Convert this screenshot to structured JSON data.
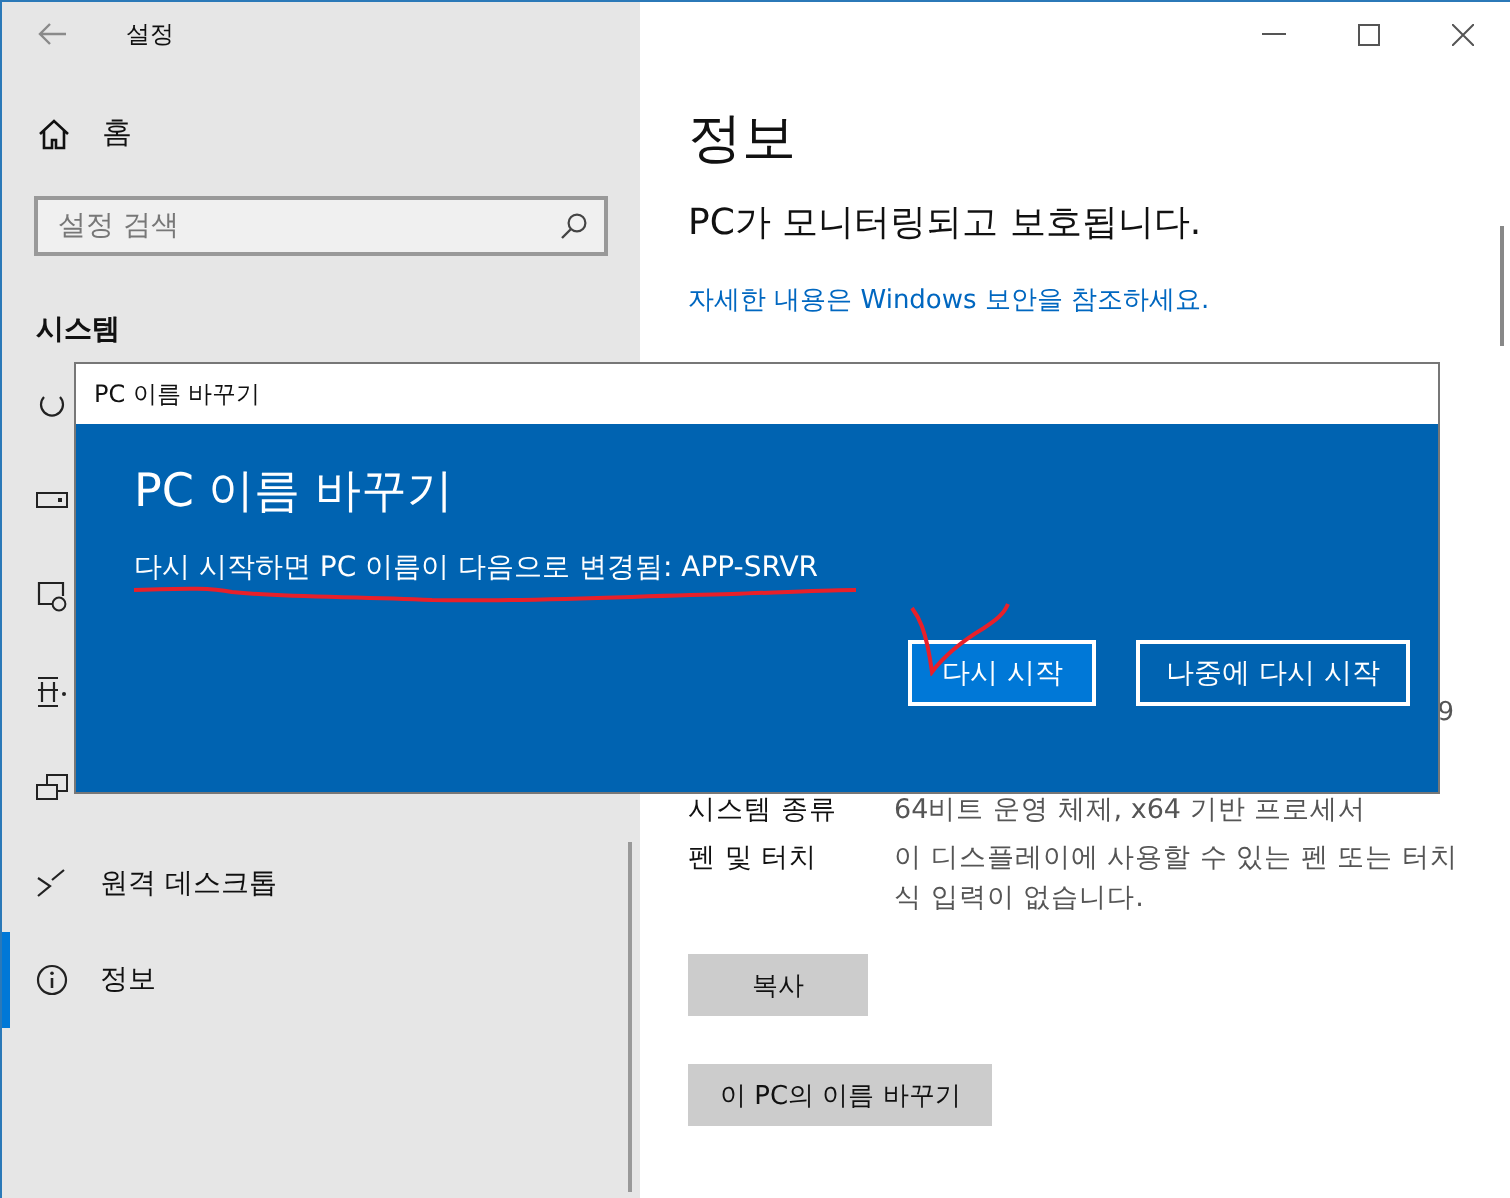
{
  "window": {
    "title": "설정"
  },
  "sidebar": {
    "home": "홈",
    "search": {
      "placeholder": "설정 검색"
    },
    "section": "시스템",
    "items": [
      {
        "selected": false
      },
      {
        "selected": false
      },
      {
        "selected": false
      },
      {
        "selected": false
      },
      {
        "selected": false
      },
      {
        "label": "원격 데스크톱",
        "selected": false
      },
      {
        "label": "정보",
        "selected": true
      }
    ]
  },
  "content": {
    "title": "정보",
    "status": "PC가 모니터링되고 보호됩니다.",
    "link": "자세한 내용은 Windows 보안을 참조하세요.",
    "spill": "9",
    "specs": [
      {
        "label": "시스템 종류",
        "value": "64비트 운영 체제, x64 기반 프로세서"
      },
      {
        "label": "펜 및 터치",
        "value": "이 디스플레이에 사용할 수 있는 펜 또는 터치식 입력이 없습니다."
      }
    ],
    "buttons": [
      "복사",
      "이 PC의 이름 바꾸기"
    ]
  },
  "dialog": {
    "title": "PC 이름 바꾸기",
    "heading": "PC 이름 바꾸기",
    "message": "다시 시작하면 PC 이름이 다음으로 변경됨: APP-SRVR",
    "buttons": [
      {
        "label": "다시 시작",
        "primary": true
      },
      {
        "label": "나중에 다시 시작",
        "primary": false
      }
    ]
  }
}
